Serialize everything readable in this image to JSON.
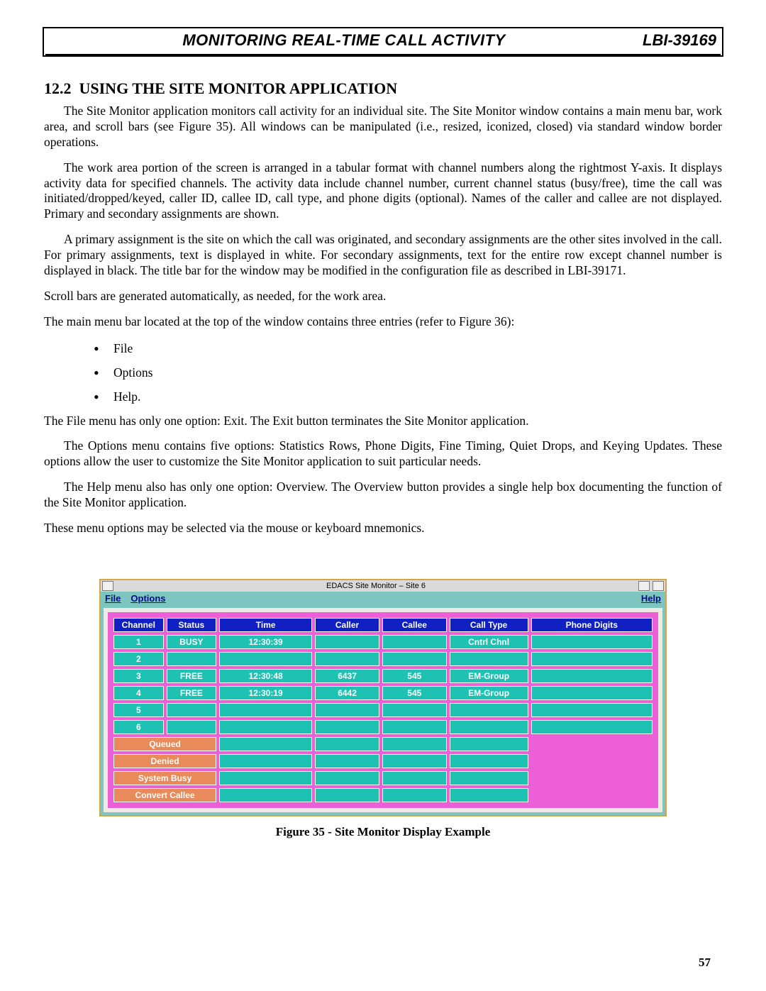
{
  "header": {
    "title": "MONITORING REAL-TIME CALL ACTIVITY",
    "doc_id": "LBI-39169"
  },
  "section": {
    "number": "12.2",
    "title": "USING THE SITE MONITOR APPLICATION"
  },
  "paragraphs": {
    "p1": "The Site Monitor application monitors call activity for an individual site.  The Site Monitor window contains a main menu bar, work area, and scroll bars (see Figure 35).  All windows can be manipulated (i.e., resized, iconized, closed) via standard window border operations.",
    "p2": "The work area portion of the screen is arranged in a tabular format with channel numbers along the rightmost Y-axis.  It displays activity data for specified channels.  The activity data include channel number, current channel status (busy/free), time the call was initiated/dropped/keyed, caller ID, callee ID, call type, and phone digits (optional).  Names of the caller and callee are not displayed.  Primary and secondary assignments are shown.",
    "p3": "A primary assignment is the site on which the call was originated, and secondary assignments are the other sites involved in the call.  For primary assignments, text is displayed in white.  For secondary assignments, text for the entire row except channel number is displayed in black.  The title bar for the window may be modified in the configuration file as described in LBI-39171.",
    "p4": "Scroll bars are generated automatically, as needed, for the work area.",
    "p5": "The main menu bar located at the top of the window contains three entries (refer to Figure 36):",
    "menu_items": [
      "File",
      "Options",
      "Help."
    ],
    "p6": "The File menu has only one option:  Exit.  The Exit button terminates the Site Monitor application.",
    "p7": "The Options menu contains five options:  Statistics Rows, Phone Digits, Fine Timing, Quiet Drops, and Keying Updates.  These options allow the user to customize the Site Monitor application to suit particular needs.",
    "p8": "The Help menu also has only one option:  Overview.  The Overview button provides a single help box documenting the function of the Site Monitor application.",
    "p9": "These menu options may be selected via the mouse or keyboard mnemonics."
  },
  "figure": {
    "caption": "Figure 35 - Site Monitor Display Example"
  },
  "app": {
    "titlebar": "EDACS Site Monitor  –  Site 6",
    "menus": {
      "file": "File",
      "options": "Options",
      "help": "Help"
    },
    "columns": [
      "Channel",
      "Status",
      "Time",
      "Caller",
      "Callee",
      "Call Type",
      "Phone Digits"
    ],
    "rows": [
      {
        "ch": "1",
        "status": "BUSY",
        "time": "12:30:39",
        "caller": "",
        "callee": "",
        "type": "Cntrl Chnl",
        "digits": ""
      },
      {
        "ch": "2",
        "status": "",
        "time": "",
        "caller": "",
        "callee": "",
        "type": "",
        "digits": ""
      },
      {
        "ch": "3",
        "status": "FREE",
        "time": "12:30:48",
        "caller": "6437",
        "callee": "545",
        "type": "EM-Group",
        "digits": ""
      },
      {
        "ch": "4",
        "status": "FREE",
        "time": "12:30:19",
        "caller": "6442",
        "callee": "545",
        "type": "EM-Group",
        "digits": ""
      },
      {
        "ch": "5",
        "status": "",
        "time": "",
        "caller": "",
        "callee": "",
        "type": "",
        "digits": ""
      },
      {
        "ch": "6",
        "status": "",
        "time": "",
        "caller": "",
        "callee": "",
        "type": "",
        "digits": ""
      }
    ],
    "status_rows": [
      "Queued",
      "Denied",
      "System Busy",
      "Convert Callee"
    ]
  },
  "page_number": "57"
}
